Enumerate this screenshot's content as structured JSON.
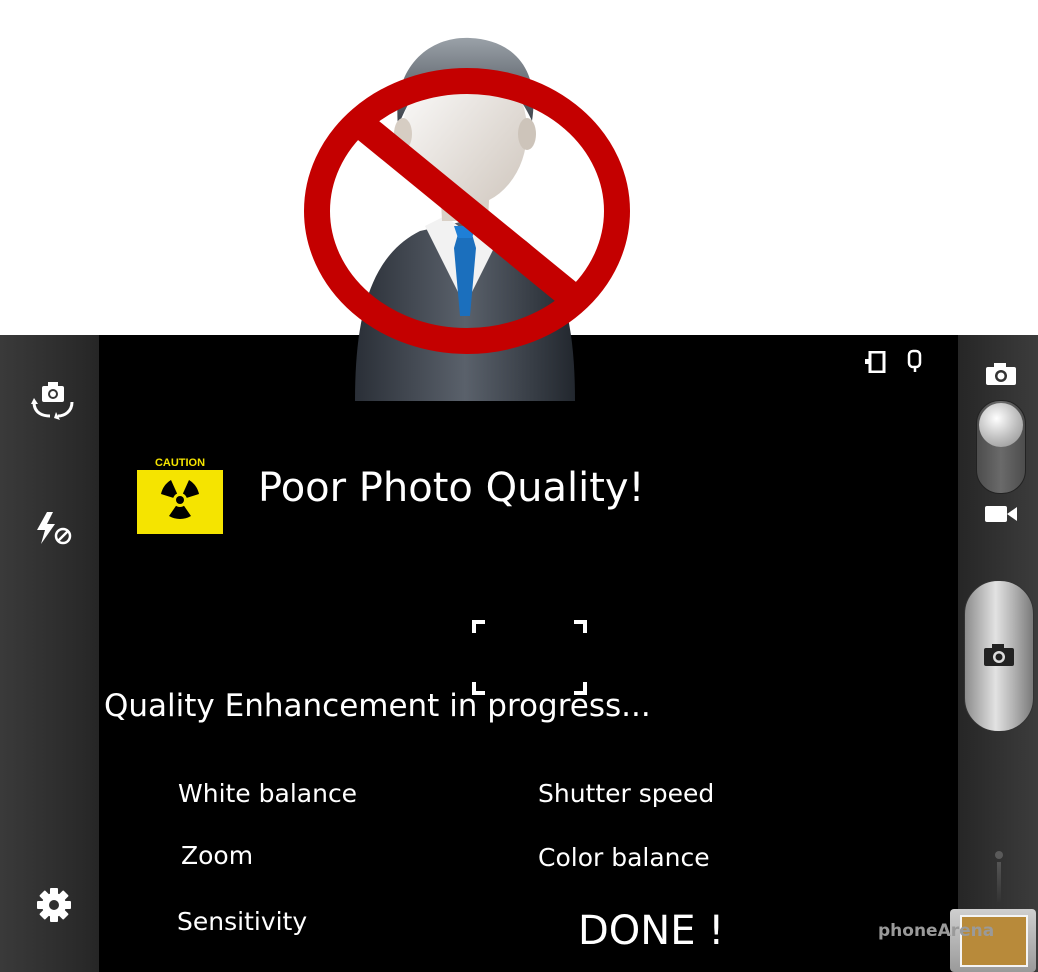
{
  "main": {
    "title": "Poor Photo Quality!",
    "caution_label": "CAUTION",
    "progress_text": "Quality Enhancement in progress...",
    "items": {
      "white_balance": "White balance",
      "shutter_speed": "Shutter speed",
      "zoom": "Zoom",
      "color_balance": "Color balance",
      "sensitivity": "Sensitivity"
    },
    "done": "DONE !"
  },
  "watermark": "phoneArena",
  "icons": {
    "left_bar": [
      "switch-camera-icon",
      "flash-off-icon",
      "settings-gear-icon"
    ],
    "right_bar": [
      "camera-mode-icon",
      "video-mode-icon",
      "shutter-camera-icon",
      "gallery-thumbnail"
    ],
    "status": [
      "battery-icon",
      "storage-icon"
    ],
    "overlay": [
      "businessman-avatar",
      "prohibition-sign-icon",
      "radiation-warning-icon"
    ]
  },
  "colors": {
    "prohibition_red": "#c40000",
    "caution_yellow": "#f5e400",
    "screen_background": "#000000"
  }
}
